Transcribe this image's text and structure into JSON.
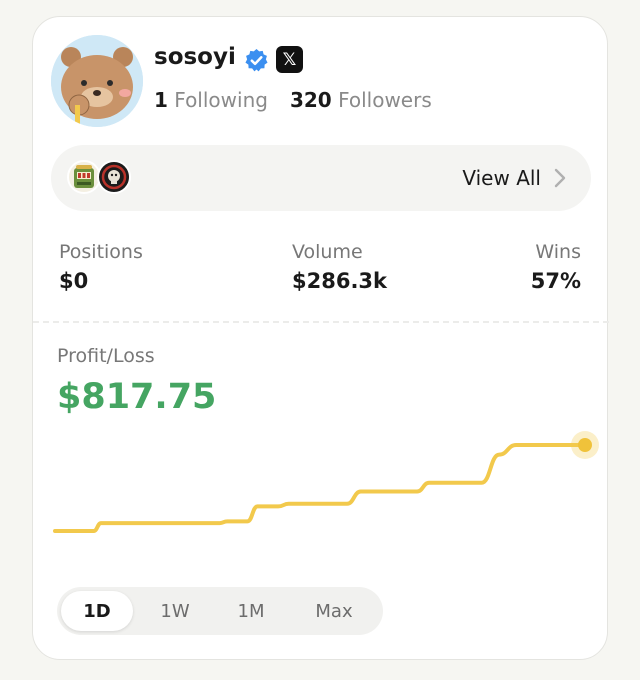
{
  "profile": {
    "username": "sosoyi",
    "verified": true,
    "social_icon": "x-logo",
    "social_glyph": "𝕏",
    "following_count": "1",
    "following_label": "Following",
    "followers_count": "320",
    "followers_label": "Followers"
  },
  "collections": {
    "items": [
      {
        "icon": "slot-machine-icon"
      },
      {
        "icon": "badge-icon"
      }
    ],
    "view_all_label": "View All"
  },
  "stats": [
    {
      "label": "Positions",
      "value": "$0"
    },
    {
      "label": "Volume",
      "value": "$286.3k"
    },
    {
      "label": "Wins",
      "value": "57%"
    }
  ],
  "profit_loss": {
    "label": "Profit/Loss",
    "value": "$817.75"
  },
  "chart_data": {
    "type": "line",
    "title": "",
    "xlabel": "",
    "ylabel": "",
    "grid": false,
    "legend": "none",
    "color": "#f2c94c",
    "x": [
      0,
      0.073,
      0.087,
      0.311,
      0.325,
      0.363,
      0.382,
      0.421,
      0.441,
      0.551,
      0.577,
      0.617,
      0.633,
      0.683,
      0.706,
      0.71,
      0.805,
      0.838,
      0.87,
      0.899,
      1
    ],
    "values": [
      0,
      0,
      9,
      9,
      11,
      11,
      28,
      28,
      31,
      31,
      45,
      45,
      45,
      45,
      55,
      55,
      55,
      87,
      98,
      98,
      98
    ]
  },
  "ranges": {
    "items": [
      "1D",
      "1W",
      "1M",
      "Max"
    ],
    "selected": "1D"
  },
  "colors": {
    "accent_green": "#45a562",
    "line_yellow": "#f2c94c",
    "verified_blue": "#3b8ff0"
  }
}
